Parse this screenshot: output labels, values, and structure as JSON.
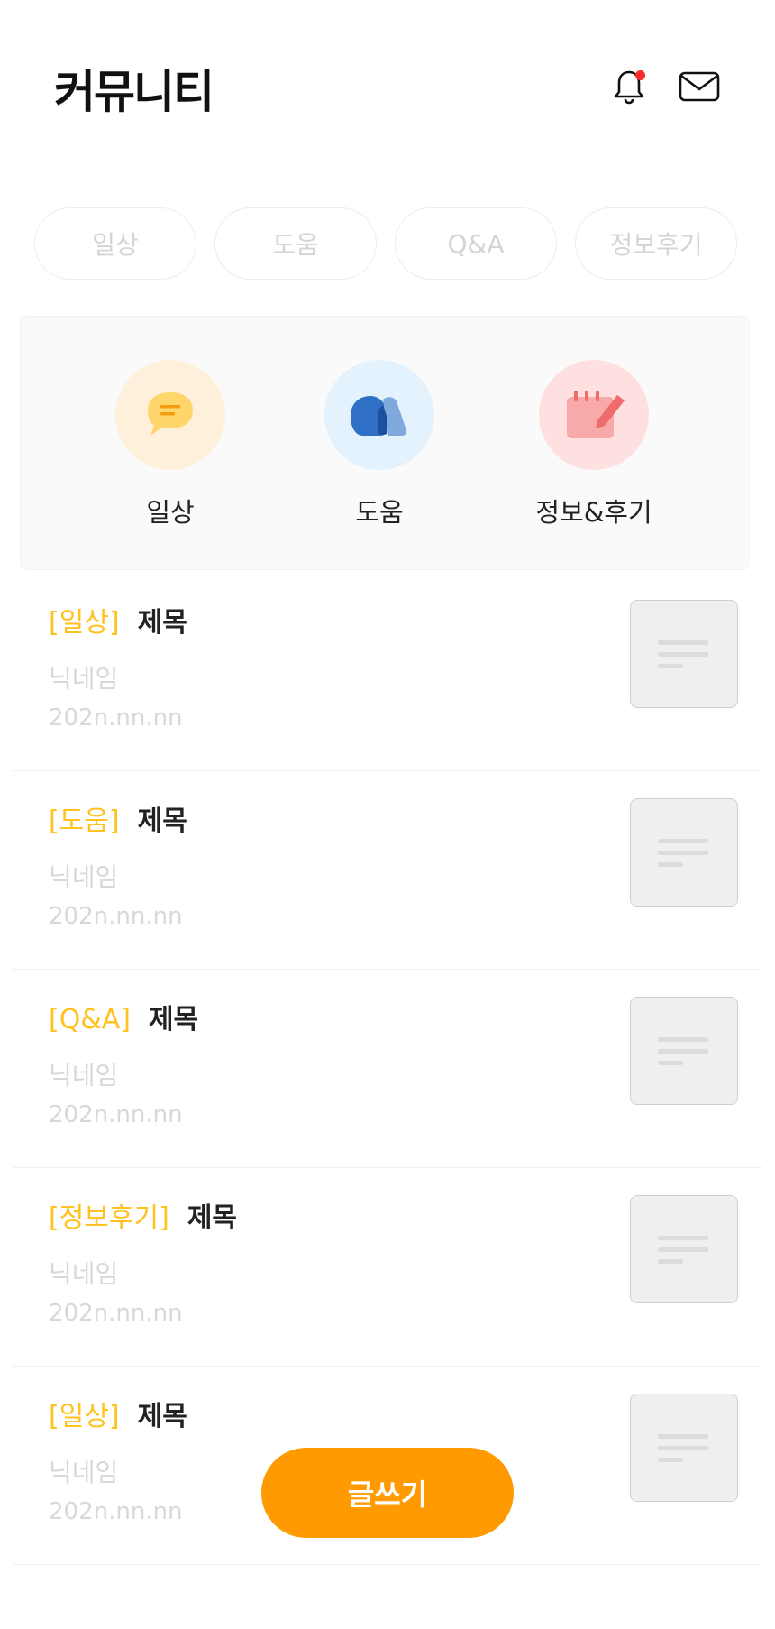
{
  "header": {
    "title": "커뮤니티",
    "bell_icon": "bell-icon",
    "mail_icon": "mail-icon",
    "notification_dot_color": "#ff2a2a"
  },
  "chips": [
    "일상",
    "도움",
    "Q&A",
    "정보후기"
  ],
  "categories": [
    {
      "label": "일상",
      "icon": "chat-bubble-icon",
      "bg": "#fff0dc"
    },
    {
      "label": "도움",
      "icon": "help-hands-icon",
      "bg": "#e4f2fd"
    },
    {
      "label": "정보&후기",
      "icon": "notepad-pencil-icon",
      "bg": "#ffe0e0"
    }
  ],
  "posts": [
    {
      "tag": "[일상]",
      "title": "제목",
      "nick": "닉네임",
      "date": "202n.nn.nn"
    },
    {
      "tag": "[도움]",
      "title": "제목",
      "nick": "닉네임",
      "date": "202n.nn.nn"
    },
    {
      "tag": "[Q&A]",
      "title": "제목",
      "nick": "닉네임",
      "date": "202n.nn.nn"
    },
    {
      "tag": "[정보후기]",
      "title": "제목",
      "nick": "닉네임",
      "date": "202n.nn.nn"
    },
    {
      "tag": "[일상]",
      "title": "제목",
      "nick": "닉네임",
      "date": "202n.nn.nn"
    }
  ],
  "write_button": {
    "label": "글쓰기",
    "color": "#ff9a00"
  },
  "colors": {
    "tag": "#ffc21f",
    "accent": "#ff9a00"
  }
}
